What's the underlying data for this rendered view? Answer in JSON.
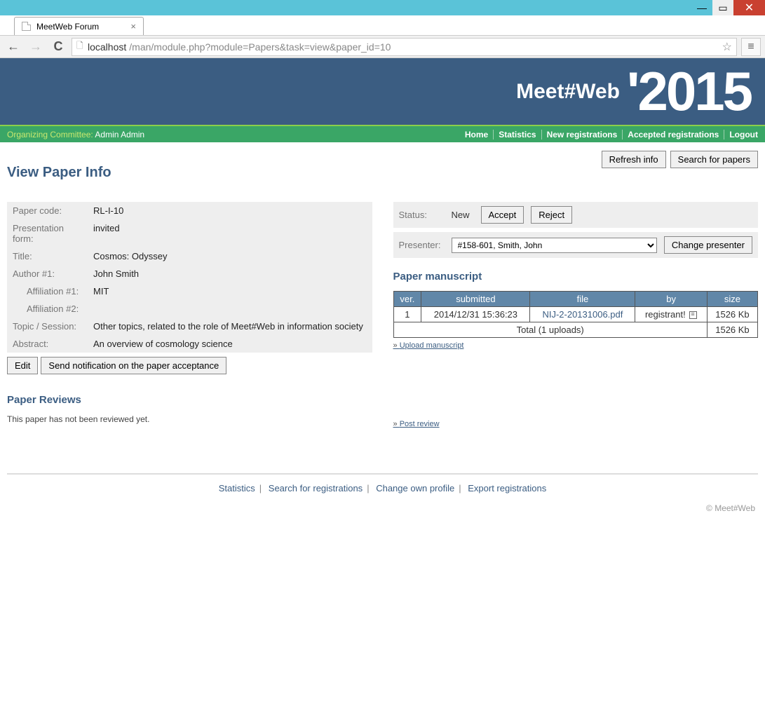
{
  "window": {
    "tab_title": "MeetWeb Forum"
  },
  "addressbar": {
    "host": "localhost",
    "path": "/man/module.php?module=Papers&task=view&paper_id=10"
  },
  "banner": {
    "brand": "Meet#Web",
    "year": "'2015"
  },
  "greenbar": {
    "committee_label": "Organizing Committee:",
    "committee_user": " Admin Admin",
    "links": {
      "home": "Home",
      "statistics": "Statistics",
      "new_reg": "New registrations",
      "accepted_reg": "Accepted registrations",
      "logout": "Logout"
    }
  },
  "top_buttons": {
    "refresh": "Refresh info",
    "search": "Search for papers"
  },
  "page_title": "View Paper Info",
  "paper": {
    "rows": {
      "code_lbl": "Paper code:",
      "code_val": "RL-I-10",
      "form_lbl": "Presentation form:",
      "form_val": "invited",
      "title_lbl": "Title:",
      "title_val": "Cosmos: Odyssey",
      "author_lbl": "Author #1:",
      "author_val": "John Smith",
      "aff1_lbl": "Affiliation #1:",
      "aff1_val": "MIT",
      "aff2_lbl": "Affiliation #2:",
      "aff2_val": "",
      "topic_lbl": "Topic / Session:",
      "topic_val": "Other topics, related to the role of Meet#Web in information society",
      "abstract_lbl": "Abstract:",
      "abstract_val": "An overview of cosmology science"
    },
    "buttons": {
      "edit": "Edit",
      "notify": "Send notification on the paper acceptance"
    }
  },
  "status": {
    "label": "Status:",
    "value": "New",
    "accept": "Accept",
    "reject": "Reject"
  },
  "presenter": {
    "label": "Presenter:",
    "selected": "#158-601, Smith, John",
    "change": "Change presenter"
  },
  "manuscript": {
    "title": "Paper manuscript",
    "headers": {
      "ver": "ver.",
      "submitted": "submitted",
      "file": "file",
      "by": "by",
      "size": "size"
    },
    "row": {
      "ver": "1",
      "submitted": "2014/12/31 15:36:23",
      "file": "NIJ-2-20131006.pdf",
      "by": "registrant!",
      "size": "1526 Kb"
    },
    "total": {
      "label": "Total (1 uploads)",
      "size": "1526 Kb"
    },
    "upload_link": "Upload manuscript"
  },
  "reviews": {
    "title": "Paper Reviews",
    "post_link": "Post review",
    "none_text": "This paper has not been reviewed yet."
  },
  "footer": {
    "links": {
      "stats": "Statistics",
      "search_reg": "Search for registrations",
      "profile": "Change own profile",
      "export": "Export registrations"
    },
    "copyright": "© Meet#Web"
  }
}
